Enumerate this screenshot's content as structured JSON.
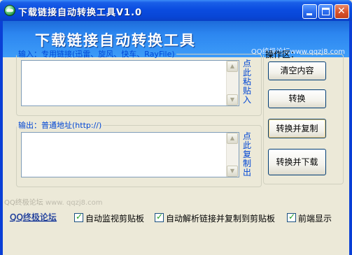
{
  "window": {
    "title": "下载链接自动转换工具V1.0"
  },
  "banner": {
    "title": "下载链接自动转换工具",
    "site": "QQ终极论坛www.qqzj8.com"
  },
  "input_group": {
    "legend": "输入：专用链接(迅雷、旋风、快车、RayFile)",
    "paste_link": "点此粘贴入",
    "value": ""
  },
  "output_group": {
    "legend": "输出：普通地址(http://)",
    "copy_link": "点此复制出",
    "value": ""
  },
  "operations": {
    "legend": "操作区：",
    "clear_label": "清空内容",
    "convert_label": "转换",
    "convert_copy_label": "转换并复制",
    "convert_download_label": "转换并下载"
  },
  "watermark": {
    "name": "QQ终极论坛",
    "url": "www. qqzj8.com"
  },
  "footer": {
    "forum_link": "QQ终极论坛",
    "options": [
      {
        "label": "自动监视剪贴板",
        "checked": true
      },
      {
        "label": "自动解析链接并复制到剪贴板",
        "checked": true
      },
      {
        "label": "前端显示",
        "checked": true
      }
    ]
  }
}
